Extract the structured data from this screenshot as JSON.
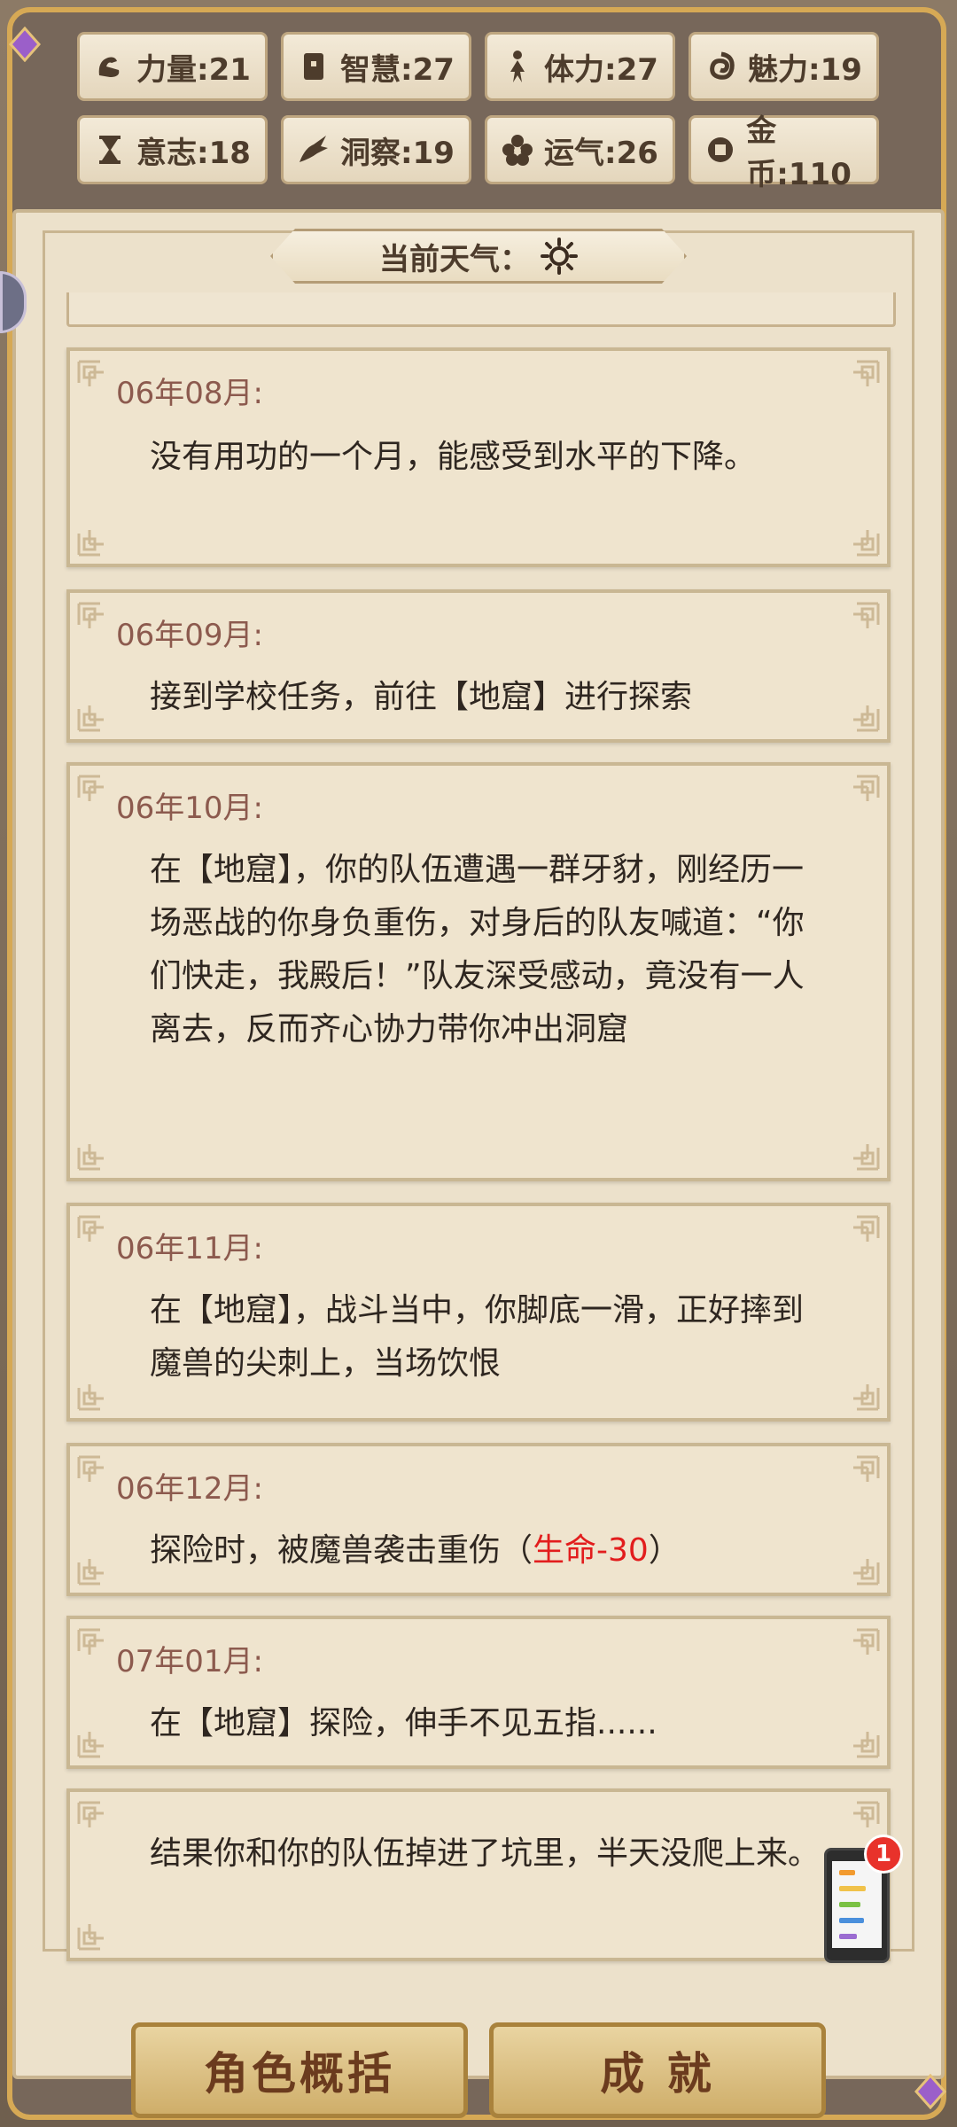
{
  "stats": [
    {
      "label": "力量:21",
      "icon": "strength-arm-icon"
    },
    {
      "label": "智慧:27",
      "icon": "book-icon"
    },
    {
      "label": "体力:27",
      "icon": "person-icon"
    },
    {
      "label": "魅力:19",
      "icon": "charm-swirl-icon"
    },
    {
      "label": "意志:18",
      "icon": "hourglass-icon"
    },
    {
      "label": "洞察:19",
      "icon": "dragon-eye-icon"
    },
    {
      "label": "运气:26",
      "icon": "clover-icon"
    },
    {
      "label": "金币:110",
      "icon": "coin-icon"
    }
  ],
  "weather": {
    "label": "当前天气：",
    "icon": "sun-icon"
  },
  "log": [
    {
      "date": "06年08月:",
      "text": "没有用功的一个月，能感受到水平的下降。"
    },
    {
      "date": "06年09月:",
      "text": "接到学校任务，前往【地窟】进行探索"
    },
    {
      "date": "06年10月:",
      "text": "在【地窟】，你的队伍遭遇一群牙豺，刚经历一场恶战的你身负重伤，对身后的队友喊道：“你们快走，我殿后！”队友深受感动，竟没有一人离去，反而齐心协力带你冲出洞窟"
    },
    {
      "date": "06年11月:",
      "text": "在【地窟】，战斗当中，你脚底一滑，正好摔到魔兽的尖刺上，当场饮恨"
    },
    {
      "date": "06年12月:",
      "text": "探险时，被魔兽袭击重伤（",
      "highlight": "生命-30",
      "tail": "）"
    },
    {
      "date": "07年01月:",
      "text": "在【地窟】探险，伸手不见五指......"
    },
    {
      "date": "",
      "text": "结果你和你的队伍掉进了坑里，半天没爬上来。"
    }
  ],
  "buttons": {
    "overview": "角色概括",
    "achievements": "成 就"
  },
  "notification": {
    "count": "1"
  }
}
